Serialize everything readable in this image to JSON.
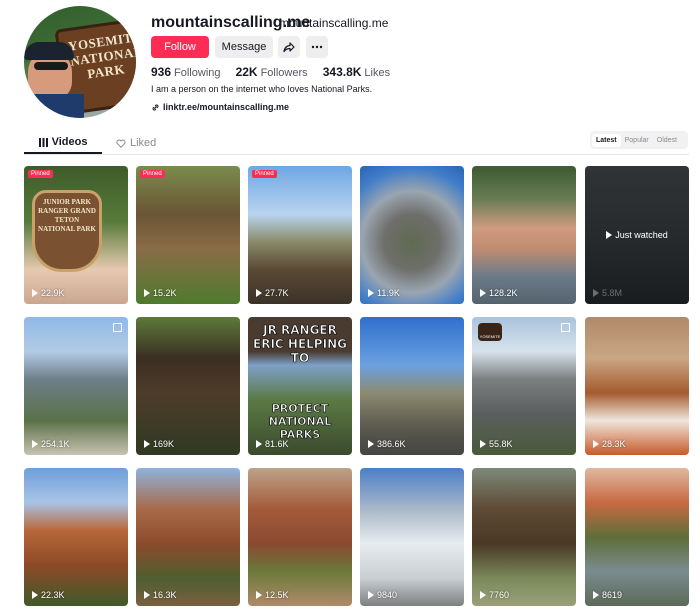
{
  "profile": {
    "username": "mountainscalling.me",
    "nickname": "mountainscalling.me",
    "avatar_sign": "YOSEMITE NATIONAL PARK",
    "follow_label": "Follow",
    "message_label": "Message",
    "share_icon": "share-icon",
    "more_icon": "more-icon",
    "following_count": "936",
    "following_label": "Following",
    "followers_count": "22K",
    "followers_label": "Followers",
    "likes_count": "343.8K",
    "likes_label": "Likes",
    "bio": "I am a person on the internet who loves National Parks.",
    "link": "linktr.ee/mountainscalling.me"
  },
  "tabs": {
    "videos": "Videos",
    "liked": "Liked"
  },
  "sort": {
    "latest": "Latest",
    "popular": "Popular",
    "oldest": "Oldest"
  },
  "videos": [
    {
      "views": "22.9K",
      "pinned": "Pinned",
      "badge": "JUNIOR PARK RANGER GRAND TETON NATIONAL PARK"
    },
    {
      "views": "15.2K",
      "pinned": "Pinned"
    },
    {
      "views": "27.7K",
      "pinned": "Pinned"
    },
    {
      "views": "11.9K"
    },
    {
      "views": "128.2K"
    },
    {
      "views": "5.8M",
      "watched": "Just watched"
    },
    {
      "views": "254.1K"
    },
    {
      "views": "169K"
    },
    {
      "views": "81.6K",
      "title": "JR RANGER ERIC HELPING TO",
      "caption": "PROTECT NATIONAL PARKS"
    },
    {
      "views": "386.6K"
    },
    {
      "views": "55.8K",
      "logo": "YOSEMITE"
    },
    {
      "views": "28.3K"
    },
    {
      "views": "22.3K"
    },
    {
      "views": "16.3K"
    },
    {
      "views": "12.5K"
    },
    {
      "views": "9840"
    },
    {
      "views": "7760"
    },
    {
      "views": "8619"
    }
  ],
  "colors": {
    "accent": "#fe2c55",
    "text": "#161823",
    "muted": "#8a8b91"
  }
}
